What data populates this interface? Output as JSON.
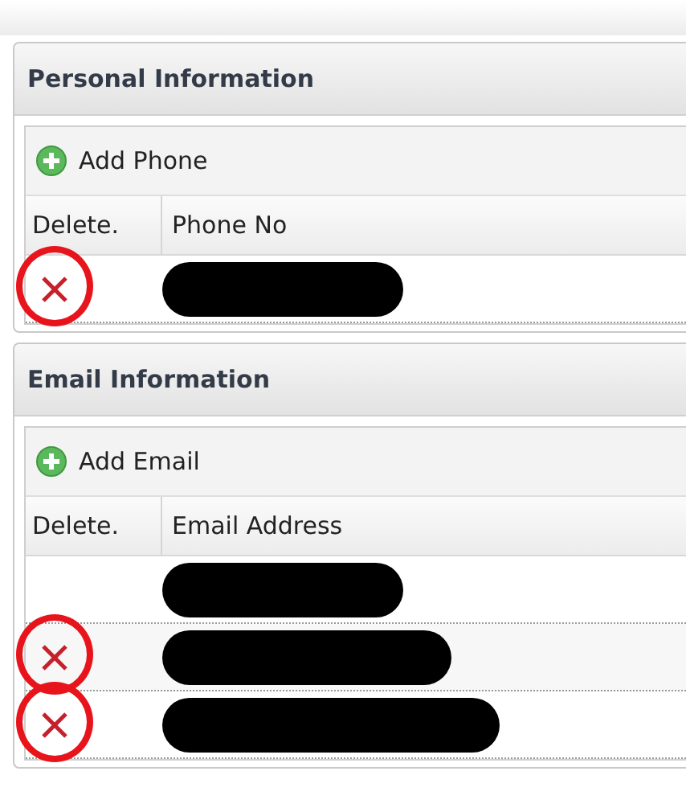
{
  "panels": [
    {
      "title": "Personal Information",
      "add_button": "Add Phone",
      "columns": [
        "Delete.",
        "Phone No"
      ],
      "rows": [
        {
          "delete_icon": true,
          "circled": true,
          "redacted": true
        }
      ]
    },
    {
      "title": "Email Information",
      "add_button": "Add Email",
      "columns": [
        "Delete.",
        "Email Address"
      ],
      "rows": [
        {
          "delete_icon": false,
          "circled": false,
          "redacted": true
        },
        {
          "delete_icon": true,
          "circled": true,
          "redacted": true
        },
        {
          "delete_icon": true,
          "circled": true,
          "redacted": true
        }
      ]
    }
  ]
}
